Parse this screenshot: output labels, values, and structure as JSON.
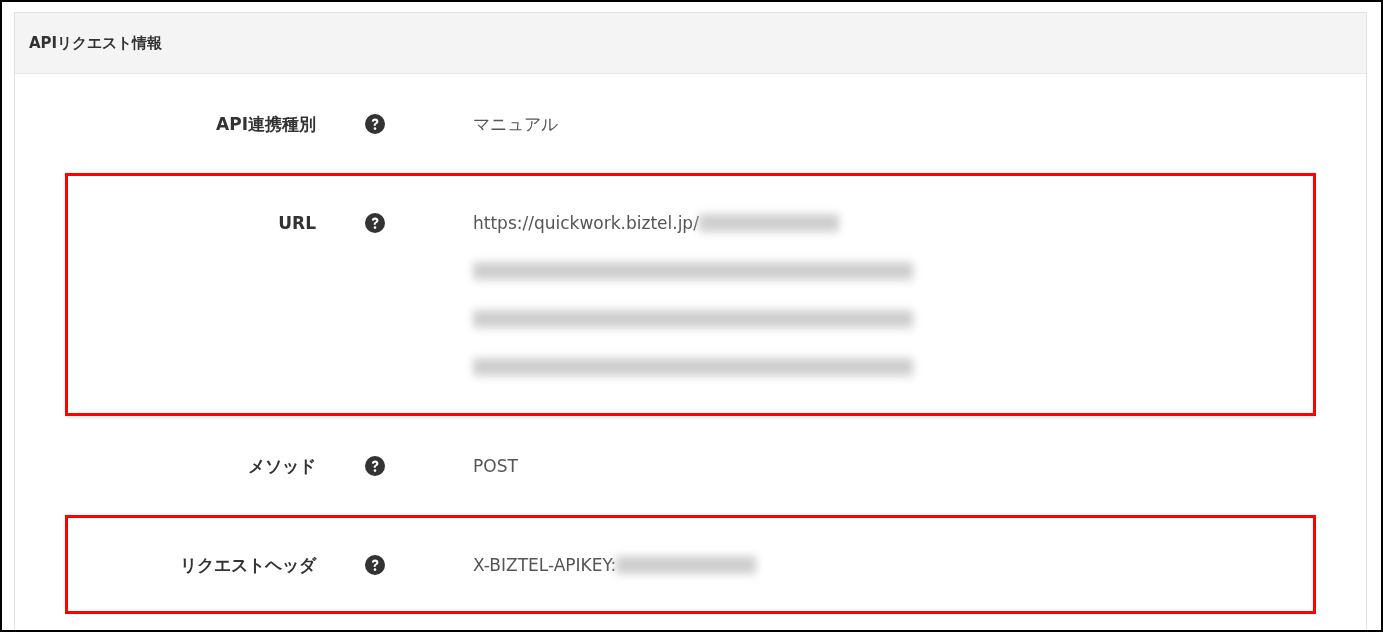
{
  "panel": {
    "title": "APIリクエスト情報"
  },
  "fields": [
    {
      "label": "API連携種別",
      "value": "マニュアル",
      "highlighted": false,
      "masked_tail": false
    },
    {
      "label": "URL",
      "value": "https://quickwork.biztel.jp/",
      "highlighted": true,
      "masked_tail": true,
      "masked_rows": [
        {
          "kind": "blur"
        },
        {
          "kind": "blur"
        },
        {
          "kind": "blur"
        }
      ]
    },
    {
      "label": "メソッド",
      "value": "POST",
      "highlighted": false,
      "masked_tail": false
    },
    {
      "label": "リクエストヘッダ",
      "value": "X-BIZTEL-APIKEY:",
      "highlighted": true,
      "masked_tail": true
    }
  ]
}
